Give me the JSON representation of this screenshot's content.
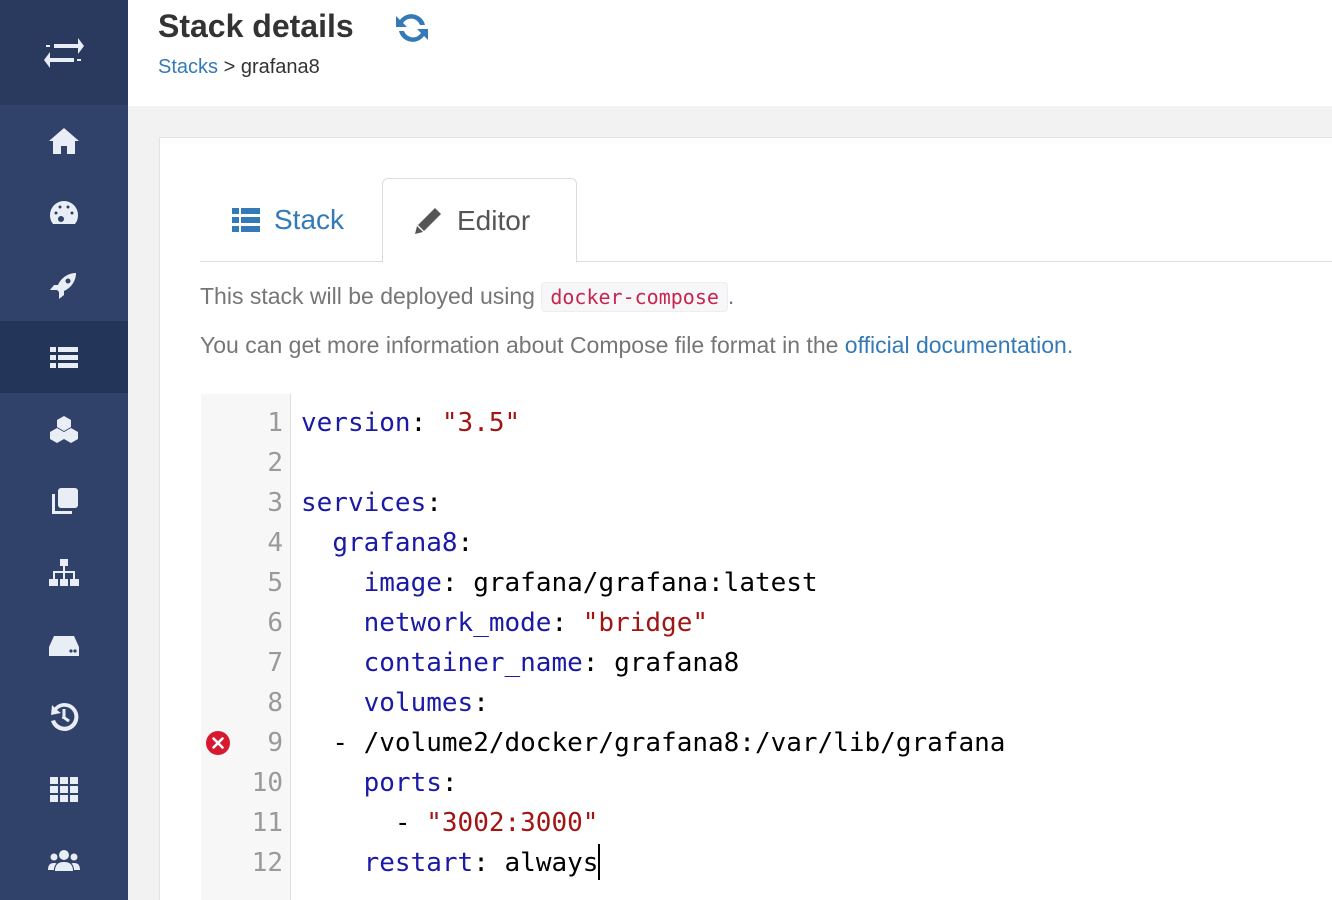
{
  "header": {
    "title": "Stack details",
    "breadcrumb": {
      "parent": "Stacks",
      "separator": ">",
      "current": "grafana8"
    }
  },
  "sidebar": {
    "items": [
      {
        "icon": "home-icon",
        "active": false
      },
      {
        "icon": "dashboard-icon",
        "active": false
      },
      {
        "icon": "rocket-icon",
        "active": false
      },
      {
        "icon": "list-icon",
        "active": true
      },
      {
        "icon": "cubes-icon",
        "active": false
      },
      {
        "icon": "clone-icon",
        "active": false
      },
      {
        "icon": "sitemap-icon",
        "active": false
      },
      {
        "icon": "hdd-icon",
        "active": false
      },
      {
        "icon": "history-icon",
        "active": false
      },
      {
        "icon": "grid-icon",
        "active": false
      },
      {
        "icon": "users-icon",
        "active": false
      }
    ]
  },
  "tabs": {
    "stack": "Stack",
    "editor": "Editor"
  },
  "info": {
    "line1_prefix": "This stack will be deployed using",
    "line1_code": "docker-compose",
    "line1_suffix": ".",
    "line2_prefix": "You can get more information about Compose file format in the",
    "line2_link": "official documentation",
    "line2_suffix": "."
  },
  "editor": {
    "lines": [
      {
        "num": "1",
        "indent": "",
        "key": "version",
        "sep": ": ",
        "value": "\"3.5\"",
        "value_type": "string"
      },
      {
        "num": "2",
        "indent": "",
        "key": "",
        "sep": "",
        "value": "",
        "value_type": "plain"
      },
      {
        "num": "3",
        "indent": "",
        "key": "services",
        "sep": ":",
        "value": "",
        "value_type": "plain"
      },
      {
        "num": "4",
        "indent": "  ",
        "key": "grafana8",
        "sep": ":",
        "value": "",
        "value_type": "plain"
      },
      {
        "num": "5",
        "indent": "    ",
        "key": "image",
        "sep": ": ",
        "value": "grafana/grafana:latest",
        "value_type": "plain"
      },
      {
        "num": "6",
        "indent": "    ",
        "key": "network_mode",
        "sep": ": ",
        "value": "\"bridge\"",
        "value_type": "string"
      },
      {
        "num": "7",
        "indent": "    ",
        "key": "container_name",
        "sep": ": ",
        "value": "grafana8",
        "value_type": "plain"
      },
      {
        "num": "8",
        "indent": "    ",
        "key": "volumes",
        "sep": ":",
        "value": "",
        "value_type": "plain"
      },
      {
        "num": "9",
        "indent": "  ",
        "key": "",
        "sep": "- ",
        "value": "/volume2/docker/grafana8:/var/lib/grafana",
        "value_type": "plain",
        "error": true
      },
      {
        "num": "10",
        "indent": "    ",
        "key": "ports",
        "sep": ":",
        "value": "",
        "value_type": "plain"
      },
      {
        "num": "11",
        "indent": "      ",
        "key": "",
        "sep": "- ",
        "value": "\"3002:3000\"",
        "value_type": "string"
      },
      {
        "num": "12",
        "indent": "    ",
        "key": "restart",
        "sep": ": ",
        "value": "always",
        "value_type": "plain",
        "cursor": true
      }
    ]
  }
}
